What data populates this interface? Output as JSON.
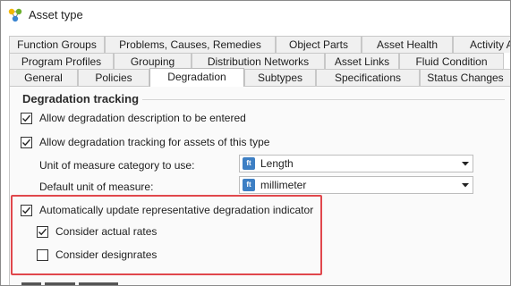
{
  "window": {
    "title": "Asset type",
    "icon": "asset-type-icon"
  },
  "tabs": {
    "row1": [
      {
        "label": "Function Groups"
      },
      {
        "label": "Problems, Causes, Remedies"
      },
      {
        "label": "Object Parts"
      },
      {
        "label": "Asset Health"
      },
      {
        "label": "Activity A"
      }
    ],
    "row2": [
      {
        "label": "Program Profiles"
      },
      {
        "label": "Grouping"
      },
      {
        "label": "Distribution Networks"
      },
      {
        "label": "Asset Links"
      },
      {
        "label": "Fluid Condition"
      }
    ],
    "row3": [
      {
        "label": "General"
      },
      {
        "label": "Policies"
      },
      {
        "label": "Degradation",
        "active": true
      },
      {
        "label": "Subtypes"
      },
      {
        "label": "Specifications"
      },
      {
        "label": "Status Changes"
      }
    ]
  },
  "degradation": {
    "section_title": "Degradation tracking",
    "allow_description": {
      "label": "Allow degradation description to be entered",
      "checked": true
    },
    "allow_tracking": {
      "label": "Allow degradation tracking for assets of this type",
      "checked": true
    },
    "uom_category": {
      "label": "Unit of measure category to use:",
      "icon_text": "ft",
      "value": "Length"
    },
    "default_uom": {
      "label": "Default unit of measure:",
      "icon_text": "ft",
      "value": "millimeter"
    },
    "auto_update": {
      "label": "Automatically update representative degradation indicator",
      "checked": true
    },
    "consider_actual": {
      "label": "Consider actual rates",
      "checked": true
    },
    "consider_design": {
      "label": "Consider designrates",
      "checked": false
    }
  },
  "colors": {
    "highlight": "#e0474c",
    "combo_icon": "#3d7fc4"
  }
}
